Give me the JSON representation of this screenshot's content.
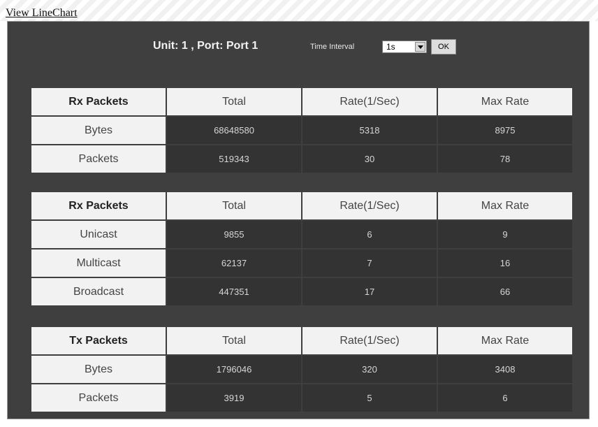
{
  "page": {
    "view_link": "View LineChart"
  },
  "header": {
    "unit_port": "Unit: 1 , Port: Port 1",
    "time_interval_label": "Time Interval",
    "time_interval_value": "1s",
    "ok_label": "OK"
  },
  "tables": [
    {
      "headers": [
        "Rx Packets",
        "Total",
        "Rate(1/Sec)",
        "Max Rate"
      ],
      "rows": [
        {
          "label": "Bytes",
          "values": [
            "68648580",
            "5318",
            "8975"
          ]
        },
        {
          "label": "Packets",
          "values": [
            "519343",
            "30",
            "78"
          ]
        }
      ]
    },
    {
      "headers": [
        "Rx Packets",
        "Total",
        "Rate(1/Sec)",
        "Max Rate"
      ],
      "rows": [
        {
          "label": "Unicast",
          "values": [
            "9855",
            "6",
            "9"
          ]
        },
        {
          "label": "Multicast",
          "values": [
            "62137",
            "7",
            "16"
          ]
        },
        {
          "label": "Broadcast",
          "values": [
            "447351",
            "17",
            "66"
          ]
        }
      ]
    },
    {
      "headers": [
        "Tx Packets",
        "Total",
        "Rate(1/Sec)",
        "Max Rate"
      ],
      "rows": [
        {
          "label": "Bytes",
          "values": [
            "1796046",
            "320",
            "3408"
          ]
        },
        {
          "label": "Packets",
          "values": [
            "3919",
            "5",
            "6"
          ]
        }
      ]
    }
  ]
}
